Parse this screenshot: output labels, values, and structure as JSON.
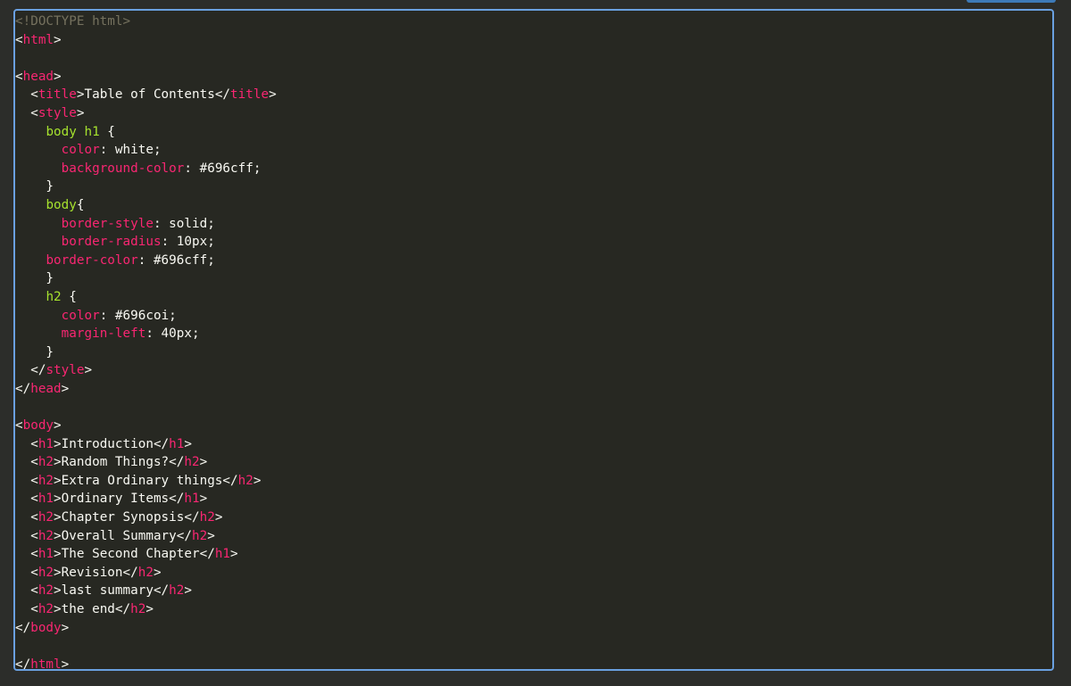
{
  "editor": {
    "lines": [
      [
        [
          "doctype",
          "<!DOCTYPE html>"
        ]
      ],
      [
        [
          "punct",
          "<"
        ],
        [
          "tag",
          "html"
        ],
        [
          "punct",
          ">"
        ]
      ],
      [],
      [
        [
          "punct",
          "<"
        ],
        [
          "tag",
          "head"
        ],
        [
          "punct",
          ">"
        ]
      ],
      [
        [
          "text",
          "  "
        ],
        [
          "punct",
          "<"
        ],
        [
          "tag",
          "title"
        ],
        [
          "punct",
          ">"
        ],
        [
          "text",
          "Table of Contents"
        ],
        [
          "punct",
          "</"
        ],
        [
          "tag",
          "title"
        ],
        [
          "punct",
          ">"
        ]
      ],
      [
        [
          "text",
          "  "
        ],
        [
          "punct",
          "<"
        ],
        [
          "tag",
          "style"
        ],
        [
          "punct",
          ">"
        ]
      ],
      [
        [
          "text",
          "    "
        ],
        [
          "sel",
          "body h1"
        ],
        [
          "text",
          " {"
        ]
      ],
      [
        [
          "text",
          "      "
        ],
        [
          "prop",
          "color"
        ],
        [
          "text",
          ": white;"
        ]
      ],
      [
        [
          "text",
          "      "
        ],
        [
          "prop",
          "background-color"
        ],
        [
          "text",
          ": #696cff;"
        ]
      ],
      [
        [
          "text",
          "    }"
        ]
      ],
      [
        [
          "text",
          "    "
        ],
        [
          "sel",
          "body"
        ],
        [
          "text",
          "{"
        ]
      ],
      [
        [
          "text",
          "      "
        ],
        [
          "prop",
          "border-style"
        ],
        [
          "text",
          ": solid;"
        ]
      ],
      [
        [
          "text",
          "      "
        ],
        [
          "prop",
          "border-radius"
        ],
        [
          "text",
          ": 10px;"
        ]
      ],
      [
        [
          "text",
          "    "
        ],
        [
          "prop",
          "border-color"
        ],
        [
          "text",
          ": #696cff;"
        ]
      ],
      [
        [
          "text",
          "    }"
        ]
      ],
      [
        [
          "text",
          "    "
        ],
        [
          "sel",
          "h2"
        ],
        [
          "text",
          " {"
        ]
      ],
      [
        [
          "text",
          "      "
        ],
        [
          "prop",
          "color"
        ],
        [
          "text",
          ": #696coi;"
        ]
      ],
      [
        [
          "text",
          "      "
        ],
        [
          "prop",
          "margin-left"
        ],
        [
          "text",
          ": 40px;"
        ]
      ],
      [
        [
          "text",
          "    }"
        ]
      ],
      [
        [
          "text",
          "  "
        ],
        [
          "punct",
          "</"
        ],
        [
          "tag",
          "style"
        ],
        [
          "punct",
          ">"
        ]
      ],
      [
        [
          "punct",
          "</"
        ],
        [
          "tag",
          "head"
        ],
        [
          "punct",
          ">"
        ]
      ],
      [],
      [
        [
          "punct",
          "<"
        ],
        [
          "tag",
          "body"
        ],
        [
          "punct",
          ">"
        ]
      ],
      [
        [
          "text",
          "  "
        ],
        [
          "punct",
          "<"
        ],
        [
          "tag",
          "h1"
        ],
        [
          "punct",
          ">"
        ],
        [
          "text",
          "Introduction"
        ],
        [
          "punct",
          "</"
        ],
        [
          "tag",
          "h1"
        ],
        [
          "punct",
          ">"
        ]
      ],
      [
        [
          "text",
          "  "
        ],
        [
          "punct",
          "<"
        ],
        [
          "tag",
          "h2"
        ],
        [
          "punct",
          ">"
        ],
        [
          "text",
          "Random Things?"
        ],
        [
          "punct",
          "</"
        ],
        [
          "tag",
          "h2"
        ],
        [
          "punct",
          ">"
        ]
      ],
      [
        [
          "text",
          "  "
        ],
        [
          "punct",
          "<"
        ],
        [
          "tag",
          "h2"
        ],
        [
          "punct",
          ">"
        ],
        [
          "text",
          "Extra Ordinary things"
        ],
        [
          "punct",
          "</"
        ],
        [
          "tag",
          "h2"
        ],
        [
          "punct",
          ">"
        ]
      ],
      [
        [
          "text",
          "  "
        ],
        [
          "punct",
          "<"
        ],
        [
          "tag",
          "h1"
        ],
        [
          "punct",
          ">"
        ],
        [
          "text",
          "Ordinary Items"
        ],
        [
          "punct",
          "</"
        ],
        [
          "tag",
          "h1"
        ],
        [
          "punct",
          ">"
        ]
      ],
      [
        [
          "text",
          "  "
        ],
        [
          "punct",
          "<"
        ],
        [
          "tag",
          "h2"
        ],
        [
          "punct",
          ">"
        ],
        [
          "text",
          "Chapter Synopsis"
        ],
        [
          "punct",
          "</"
        ],
        [
          "tag",
          "h2"
        ],
        [
          "punct",
          ">"
        ]
      ],
      [
        [
          "text",
          "  "
        ],
        [
          "punct",
          "<"
        ],
        [
          "tag",
          "h2"
        ],
        [
          "punct",
          ">"
        ],
        [
          "text",
          "Overall Summary"
        ],
        [
          "punct",
          "</"
        ],
        [
          "tag",
          "h2"
        ],
        [
          "punct",
          ">"
        ]
      ],
      [
        [
          "text",
          "  "
        ],
        [
          "punct",
          "<"
        ],
        [
          "tag",
          "h1"
        ],
        [
          "punct",
          ">"
        ],
        [
          "text",
          "The Second Chapter"
        ],
        [
          "punct",
          "</"
        ],
        [
          "tag",
          "h1"
        ],
        [
          "punct",
          ">"
        ]
      ],
      [
        [
          "text",
          "  "
        ],
        [
          "punct",
          "<"
        ],
        [
          "tag",
          "h2"
        ],
        [
          "punct",
          ">"
        ],
        [
          "text",
          "Revision"
        ],
        [
          "punct",
          "</"
        ],
        [
          "tag",
          "h2"
        ],
        [
          "punct",
          ">"
        ]
      ],
      [
        [
          "text",
          "  "
        ],
        [
          "punct",
          "<"
        ],
        [
          "tag",
          "h2"
        ],
        [
          "punct",
          ">"
        ],
        [
          "text",
          "last summary"
        ],
        [
          "punct",
          "</"
        ],
        [
          "tag",
          "h2"
        ],
        [
          "punct",
          ">"
        ]
      ],
      [
        [
          "text",
          "  "
        ],
        [
          "punct",
          "<"
        ],
        [
          "tag",
          "h2"
        ],
        [
          "punct",
          ">"
        ],
        [
          "text",
          "the end"
        ],
        [
          "punct",
          "</"
        ],
        [
          "tag",
          "h2"
        ],
        [
          "punct",
          ">"
        ]
      ],
      [
        [
          "punct",
          "</"
        ],
        [
          "tag",
          "body"
        ],
        [
          "punct",
          ">"
        ]
      ],
      [],
      [
        [
          "punct",
          "</"
        ],
        [
          "tag",
          "html"
        ],
        [
          "punct",
          ">"
        ]
      ]
    ]
  },
  "theme": {
    "background": "#272822",
    "border": "#6aa0e0",
    "tag": "#f92672",
    "selector": "#a6e22e",
    "comment": "#75715e",
    "text": "#f8f8f2"
  }
}
